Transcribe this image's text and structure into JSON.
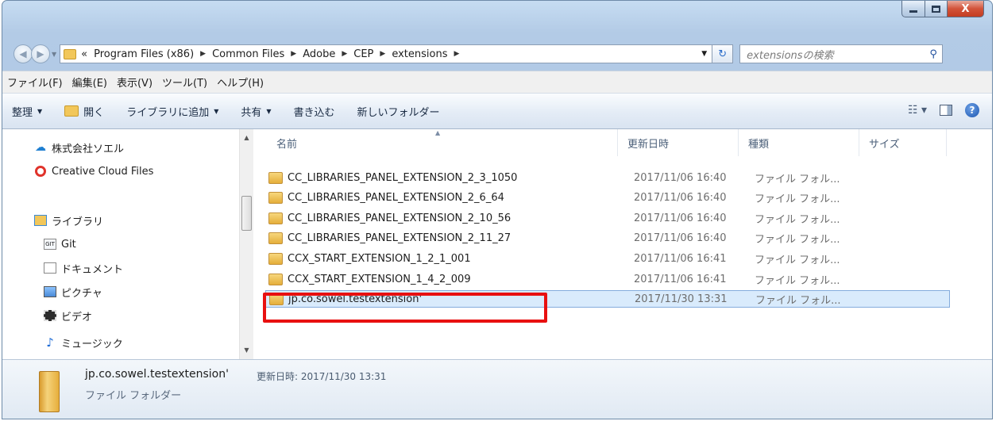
{
  "window": {
    "controls": {
      "minimize": "–",
      "maximize": "□",
      "close": "X"
    }
  },
  "address": {
    "overflow": "«",
    "crumbs": [
      "Program Files (x86)",
      "Common Files",
      "Adobe",
      "CEP",
      "extensions"
    ],
    "search_placeholder": "extensionsの検索"
  },
  "menu": [
    "ファイル(F)",
    "編集(E)",
    "表示(V)",
    "ツール(T)",
    "ヘルプ(H)"
  ],
  "toolbar": {
    "organize": "整理",
    "open": "開く",
    "add_to_library": "ライブラリに追加",
    "share": "共有",
    "burn": "書き込む",
    "new_folder": "新しいフォルダー"
  },
  "nav": {
    "items": [
      {
        "label": "株式会社ソエル",
        "icon": "cloud-icon"
      },
      {
        "label": "Creative Cloud Files",
        "icon": "creative-cloud-icon"
      },
      {
        "label": "ライブラリ",
        "icon": "library-icon"
      },
      {
        "label": "Git",
        "icon": "git-icon"
      },
      {
        "label": "ドキュメント",
        "icon": "document-icon"
      },
      {
        "label": "ピクチャ",
        "icon": "picture-icon"
      },
      {
        "label": "ビデオ",
        "icon": "video-icon"
      },
      {
        "label": "ミュージック",
        "icon": "music-icon"
      }
    ]
  },
  "columns": {
    "name": "名前",
    "date": "更新日時",
    "type": "種類",
    "size": "サイズ"
  },
  "files": [
    {
      "name": "CC_LIBRARIES_PANEL_EXTENSION_2_3_1050",
      "date": "2017/11/06 16:40",
      "type": "ファイル フォル..."
    },
    {
      "name": "CC_LIBRARIES_PANEL_EXTENSION_2_6_64",
      "date": "2017/11/06 16:40",
      "type": "ファイル フォル..."
    },
    {
      "name": "CC_LIBRARIES_PANEL_EXTENSION_2_10_56",
      "date": "2017/11/06 16:40",
      "type": "ファイル フォル..."
    },
    {
      "name": "CC_LIBRARIES_PANEL_EXTENSION_2_11_27",
      "date": "2017/11/06 16:40",
      "type": "ファイル フォル..."
    },
    {
      "name": "CCX_START_EXTENSION_1_2_1_001",
      "date": "2017/11/06 16:41",
      "type": "ファイル フォル..."
    },
    {
      "name": "CCX_START_EXTENSION_1_4_2_009",
      "date": "2017/11/06 16:41",
      "type": "ファイル フォル..."
    },
    {
      "name": "jp.co.sowel.testextension'",
      "date": "2017/11/30 13:31",
      "type": "ファイル フォル..."
    }
  ],
  "selected_index": 6,
  "details": {
    "name": "jp.co.sowel.testextension'",
    "modified_label": "更新日時: 2017/11/30 13:31",
    "type": "ファイル フォルダー"
  }
}
